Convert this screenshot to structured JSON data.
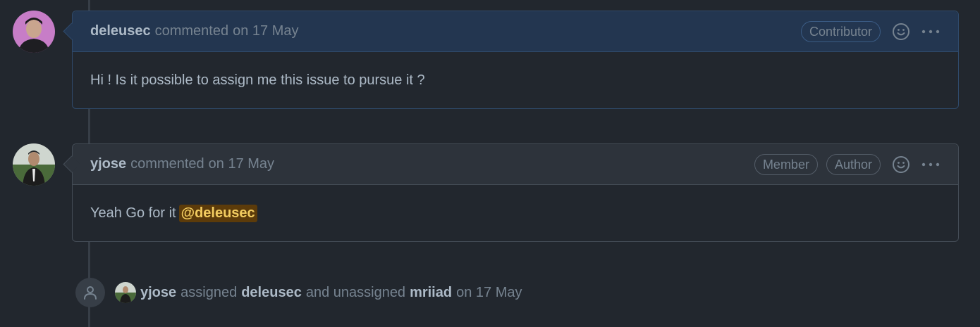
{
  "comments": [
    {
      "author": "deleusec",
      "action": "commented",
      "date": "on 17 May",
      "badges": [
        "Contributor"
      ],
      "body": "Hi ! Is it possible to assign me this issue to pursue it ?",
      "avatar_icon": "user-avatar"
    },
    {
      "author": "yjose",
      "action": "commented",
      "date": "on 17 May",
      "badges": [
        "Member",
        "Author"
      ],
      "body": "Yeah Go for it",
      "mention": "@deleusec",
      "avatar_icon": "user-avatar"
    }
  ],
  "event": {
    "actor": "yjose",
    "verb1": "assigned",
    "target1": "deleusec",
    "verb2": "and unassigned",
    "target2": "mriiad",
    "date": "on 17 May",
    "icon": "person-icon"
  },
  "colors": {
    "background": "#22272e",
    "header_own": "#233650",
    "header_other": "#2d333b",
    "mention_bg": "#5c3b0a",
    "mention_fg": "#f2cc60"
  }
}
